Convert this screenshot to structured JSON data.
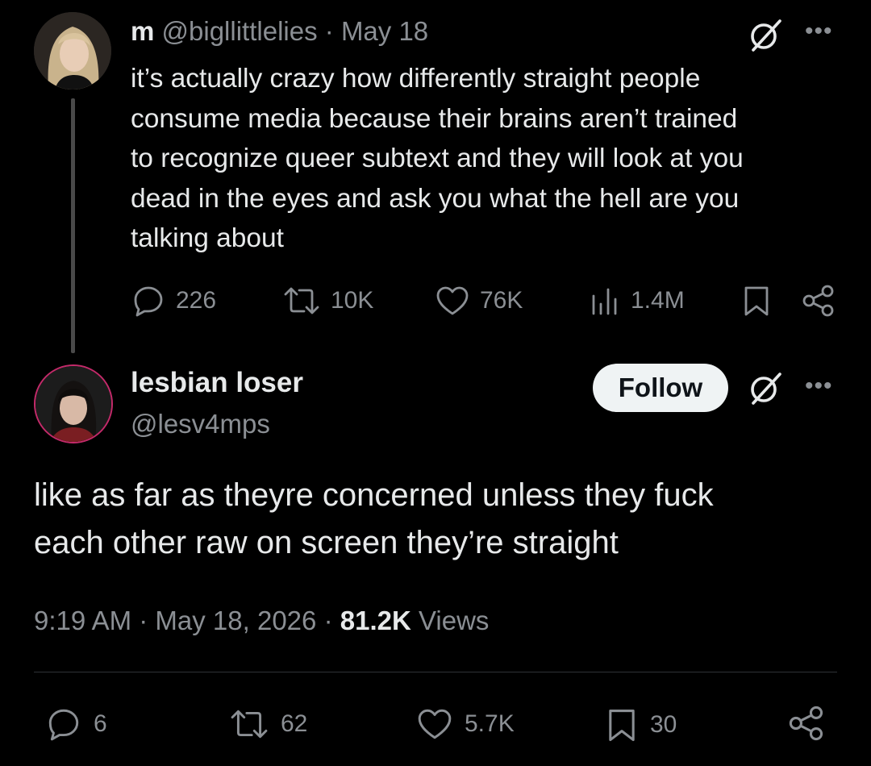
{
  "parent_tweet": {
    "display_name": "m",
    "handle": "@bigllittlelies",
    "separator": "·",
    "date": "May 18",
    "text": "it’s actually crazy how differently straight people\nconsume media because their brains aren’t trained\nto recognize queer subtext and they will look at you\ndead in the eyes and ask you what the hell are you\ntalking about",
    "stats": {
      "replies": "226",
      "reposts": "10K",
      "likes": "76K",
      "views": "1.4M"
    }
  },
  "reply_tweet": {
    "display_name": "lesbian loser",
    "handle": "@lesv4mps",
    "follow_label": "Follow",
    "text": "like as far as theyre concerned unless they fuck\neach other raw on screen they’re straight",
    "time": "9:19 AM",
    "separator": "·",
    "date": "May 18, 2026",
    "views_count": "81.2K",
    "views_label": "Views",
    "stats": {
      "replies": "6",
      "reposts": "62",
      "likes": "5.7K",
      "bookmarks": "30"
    }
  },
  "icons": {
    "grok": "grok-icon",
    "more": "more-icon",
    "reply": "reply-icon",
    "repost": "repost-icon",
    "like": "heart-icon",
    "views": "views-icon",
    "bookmark": "bookmark-icon",
    "share": "share-icon"
  },
  "colors": {
    "background": "#000000",
    "text_primary": "#e7e9ea",
    "text_secondary": "#8b8f94",
    "divider": "#2f3336",
    "follow_bg": "#eff3f4",
    "avatar_ring": "#c42a6a"
  }
}
